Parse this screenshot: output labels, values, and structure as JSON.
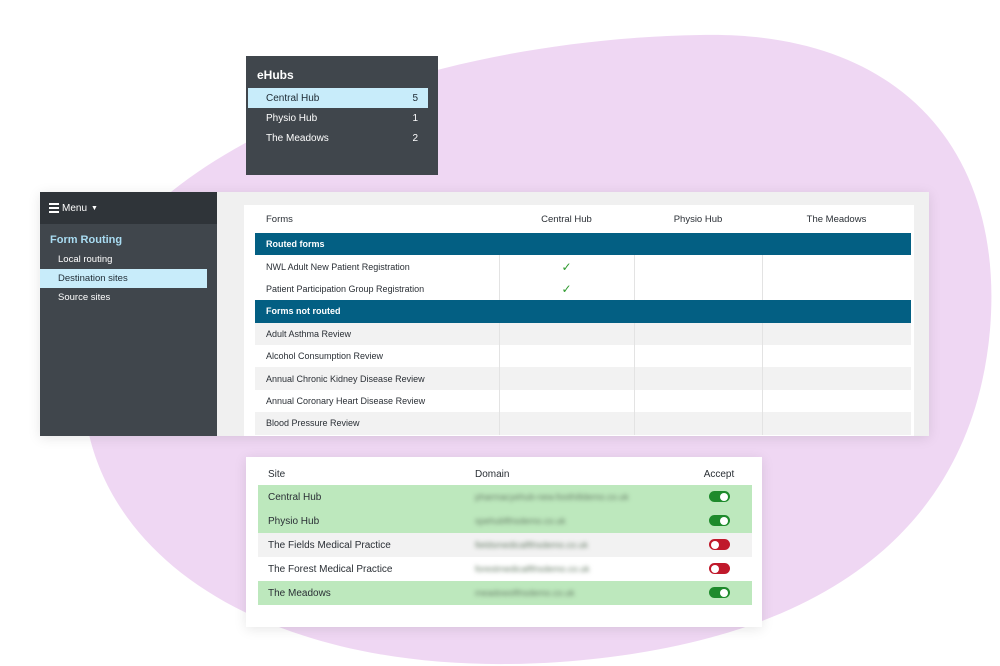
{
  "colors": {
    "blob": "#efd7f3",
    "panel_dark": "#40464c",
    "active_highlight": "#c8ecfa",
    "group_header": "#035f83",
    "check_green": "#2e9a2e",
    "accept_row": "#bde8bd",
    "toggle_on": "#1e8a2c",
    "toggle_off": "#c0192b"
  },
  "ehubs": {
    "title": "eHubs",
    "hubs": [
      {
        "name": "Central Hub",
        "count": "5",
        "active": true
      },
      {
        "name": "Physio Hub",
        "count": "1",
        "active": false
      },
      {
        "name": "The Meadows",
        "count": "2",
        "active": false
      }
    ]
  },
  "routing": {
    "menu_label": "Menu",
    "menu_icon": "hamburger-icon",
    "section": "Form Routing",
    "nav": [
      {
        "label": "Local routing",
        "active": false
      },
      {
        "label": "Destination sites",
        "active": true
      },
      {
        "label": "Source sites",
        "active": false
      }
    ],
    "table": {
      "headers": [
        "Forms",
        "Central Hub",
        "Physio Hub",
        "The Meadows"
      ],
      "groups": [
        {
          "label": "Routed forms",
          "rows": [
            {
              "form": "NWL Adult New Patient Registration",
              "checks": [
                true,
                false,
                false
              ]
            },
            {
              "form": "Patient Participation Group Registration",
              "checks": [
                true,
                false,
                false
              ]
            }
          ]
        },
        {
          "label": "Forms not routed",
          "rows": [
            {
              "form": "Adult Asthma Review",
              "checks": [
                false,
                false,
                false
              ]
            },
            {
              "form": "Alcohol Consumption Review",
              "checks": [
                false,
                false,
                false
              ]
            },
            {
              "form": "Annual Chronic Kidney Disease Review",
              "checks": [
                false,
                false,
                false
              ]
            },
            {
              "form": "Annual Coronary Heart Disease Review",
              "checks": [
                false,
                false,
                false
              ]
            },
            {
              "form": "Blood Pressure Review",
              "checks": [
                false,
                false,
                false
              ]
            }
          ]
        }
      ],
      "check_glyph": "✓"
    }
  },
  "sites": {
    "headers": {
      "site": "Site",
      "domain": "Domain",
      "accept": "Accept"
    },
    "rows": [
      {
        "site": "Central Hub",
        "domain": "pharmacyehub-new.foothilldemo.co.uk",
        "accept": true
      },
      {
        "site": "Physio Hub",
        "domain": "spehubfthsdemo.co.uk",
        "accept": true
      },
      {
        "site": "The Fields Medical Practice",
        "domain": "fieldsmedicalfthsdemo.co.uk",
        "accept": false
      },
      {
        "site": "The Forest Medical Practice",
        "domain": "forestmedicalfthsdemo.co.uk",
        "accept": false
      },
      {
        "site": "The Meadows",
        "domain": "meadowsfthsdemo.co.uk",
        "accept": true
      }
    ]
  }
}
